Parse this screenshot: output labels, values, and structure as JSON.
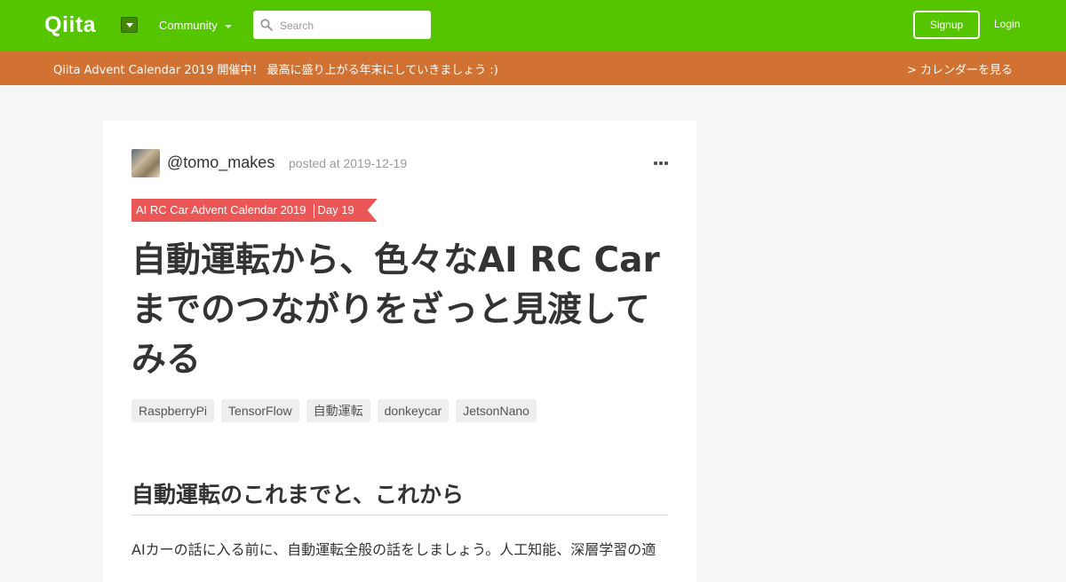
{
  "nav": {
    "logo": "Qiita",
    "community_label": "Community",
    "search_placeholder": "Search",
    "signup_label": "Signup",
    "login_label": "Login",
    "colors": {
      "background": "#55c500",
      "banner": "#d17132"
    }
  },
  "banner": {
    "text": "Qiita Advent Calendar 2019 開催中！ 最高に盛り上がる年末にしていきましょう :)",
    "link": "> カレンダーを見る"
  },
  "article": {
    "author": "@tomo_makes",
    "posted_at": "posted at 2019-12-19",
    "calendar_name": "AI RC Car Advent Calendar 2019",
    "calendar_day": "Day 19",
    "title": "自動運転から、色々なAI RC Carまでのつながりをざっと見渡してみる",
    "tags": [
      "RaspberryPi",
      "TensorFlow",
      "自動運転",
      "donkeycar",
      "JetsonNano"
    ],
    "heading": "自動運転のこれまでと、これから",
    "paragraph": "AIカーの話に入る前に、自動運転全般の話をしましょう。人工知能、深層学習の適"
  }
}
